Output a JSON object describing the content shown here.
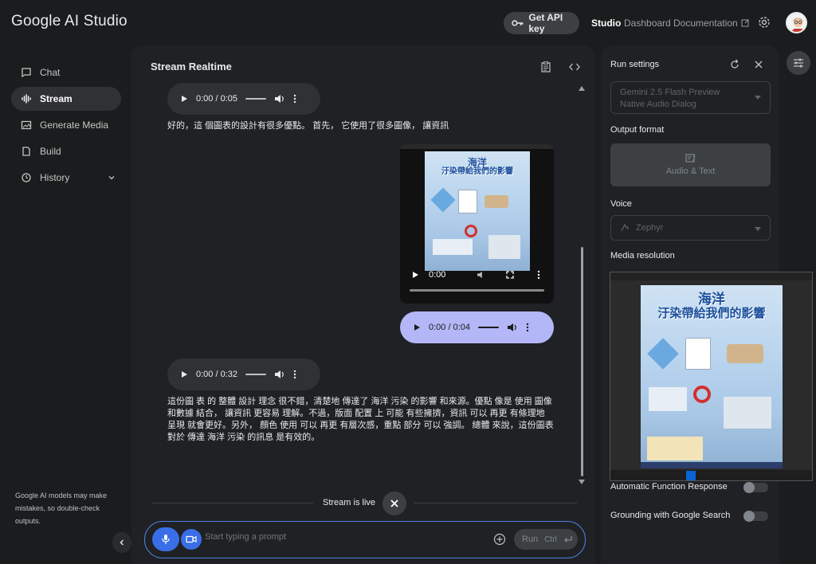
{
  "app": {
    "title": "Google AI Studio"
  },
  "header": {
    "api_key_label": "Get API key",
    "nav": {
      "studio": "Studio",
      "dashboard": "Dashboard",
      "documentation": "Documentation"
    }
  },
  "sidebar": {
    "items": [
      {
        "label": "Chat",
        "icon": "chat-icon"
      },
      {
        "label": "Stream",
        "icon": "waveform-icon"
      },
      {
        "label": "Generate Media",
        "icon": "media-icon"
      },
      {
        "label": "Build",
        "icon": "build-icon"
      },
      {
        "label": "History",
        "icon": "history-icon"
      }
    ],
    "disclaimer": "Google AI models may make mistakes, so double-check outputs."
  },
  "main": {
    "title": "Stream Realtime",
    "messages": {
      "audio1_time": "0:00 / 0:05",
      "text1": "好的，這 個圖表的設計有很多優點。 首先， 它使用了很多圖像， 讓資訊",
      "video_time": "0:00",
      "audio_user_time": "0:00 / 0:04",
      "audio2_time": "0:00 / 0:32",
      "text2": "這份圖 表 的 整體 設計 理念 很不錯，清楚地 傳達了 海洋 污染 的影響 和來源。優點 像是 使用 圖像 和數據 結合， 讓資訊 更容易 理解。不過，版面 配置 上 可能 有些擁擠，資訊 可以 再更 有條理地 呈現 就會更好。另外， 顏色 使用 可以 再更 有層次感，重點 部分 可以 強調。 總體 來說，這份圖表 對於 傳達 海洋 污染 的訊息 是有效的。"
    },
    "live_status": "Stream is live",
    "prompt_placeholder": "Start typing a prompt",
    "run_label": "Run",
    "run_shortcut": "Ctrl"
  },
  "poster": {
    "title_line1": "海洋",
    "title_line2": "汙染帶給我們的影響"
  },
  "settings": {
    "title": "Run settings",
    "model_label": "Gemini 2.5 Flash Preview Native Audio Dialog",
    "output_format_label": "Output format",
    "output_format_value": "Audio & Text",
    "voice_label": "Voice",
    "voice_value": "Zephyr",
    "media_resolution_label": "Media resolution",
    "auto_function_label": "Automatic Function Response",
    "grounding_label": "Grounding with Google Search"
  },
  "colors": {
    "accent": "#3a6ee8",
    "user_bubble": "#b3b7f7",
    "panel": "#202124",
    "background": "#1b1c1d"
  }
}
